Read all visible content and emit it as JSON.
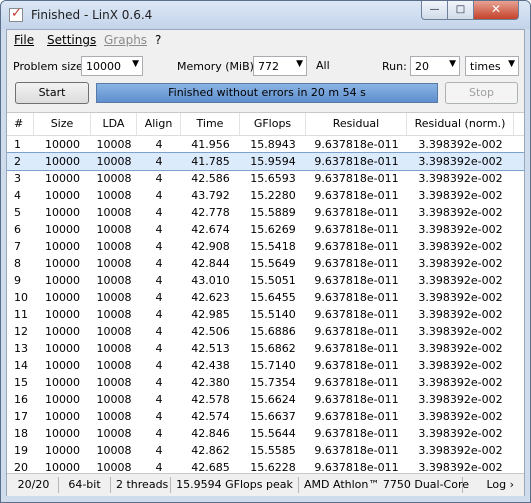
{
  "window": {
    "title": "Finished - LinX 0.6.4",
    "min_glyph": "—",
    "max_glyph": "□",
    "close_glyph": "✕",
    "app_icon_glyph": "✓",
    "app_icon_name": "checkmark-icon"
  },
  "menu": [
    {
      "label": "File",
      "enabled": true
    },
    {
      "label": "Settings",
      "enabled": true
    },
    {
      "label": "Graphs",
      "enabled": false
    },
    {
      "label": "?",
      "enabled": true
    }
  ],
  "controls": {
    "problem_size_label": "Problem size:",
    "problem_size_value": "10000",
    "memory_label": "Memory (MiB):",
    "memory_value": "772",
    "all_label": "All",
    "run_label": "Run:",
    "run_value": "20",
    "run_unit": "times",
    "dropdown_glyph": "▼"
  },
  "buttons": {
    "start": "Start",
    "stop": "Stop"
  },
  "progress": {
    "text": "Finished without errors in 20 m 54 s",
    "fraction": 1.0
  },
  "table": {
    "columns": [
      "#",
      "Size",
      "LDA",
      "Align",
      "Time",
      "GFlops",
      "Residual",
      "Residual (norm.)"
    ],
    "selected_row": 2,
    "rows": [
      [
        "1",
        "10000",
        "10008",
        "4",
        "41.956",
        "15.8943",
        "9.637818e-011",
        "3.398392e-002"
      ],
      [
        "2",
        "10000",
        "10008",
        "4",
        "41.785",
        "15.9594",
        "9.637818e-011",
        "3.398392e-002"
      ],
      [
        "3",
        "10000",
        "10008",
        "4",
        "42.586",
        "15.6593",
        "9.637818e-011",
        "3.398392e-002"
      ],
      [
        "4",
        "10000",
        "10008",
        "4",
        "43.792",
        "15.2280",
        "9.637818e-011",
        "3.398392e-002"
      ],
      [
        "5",
        "10000",
        "10008",
        "4",
        "42.778",
        "15.5889",
        "9.637818e-011",
        "3.398392e-002"
      ],
      [
        "6",
        "10000",
        "10008",
        "4",
        "42.674",
        "15.6269",
        "9.637818e-011",
        "3.398392e-002"
      ],
      [
        "7",
        "10000",
        "10008",
        "4",
        "42.908",
        "15.5418",
        "9.637818e-011",
        "3.398392e-002"
      ],
      [
        "8",
        "10000",
        "10008",
        "4",
        "42.844",
        "15.5649",
        "9.637818e-011",
        "3.398392e-002"
      ],
      [
        "9",
        "10000",
        "10008",
        "4",
        "43.010",
        "15.5051",
        "9.637818e-011",
        "3.398392e-002"
      ],
      [
        "10",
        "10000",
        "10008",
        "4",
        "42.623",
        "15.6455",
        "9.637818e-011",
        "3.398392e-002"
      ],
      [
        "11",
        "10000",
        "10008",
        "4",
        "42.985",
        "15.5140",
        "9.637818e-011",
        "3.398392e-002"
      ],
      [
        "12",
        "10000",
        "10008",
        "4",
        "42.506",
        "15.6886",
        "9.637818e-011",
        "3.398392e-002"
      ],
      [
        "13",
        "10000",
        "10008",
        "4",
        "42.513",
        "15.6862",
        "9.637818e-011",
        "3.398392e-002"
      ],
      [
        "14",
        "10000",
        "10008",
        "4",
        "42.438",
        "15.7140",
        "9.637818e-011",
        "3.398392e-002"
      ],
      [
        "15",
        "10000",
        "10008",
        "4",
        "42.380",
        "15.7354",
        "9.637818e-011",
        "3.398392e-002"
      ],
      [
        "16",
        "10000",
        "10008",
        "4",
        "42.578",
        "15.6624",
        "9.637818e-011",
        "3.398392e-002"
      ],
      [
        "17",
        "10000",
        "10008",
        "4",
        "42.574",
        "15.6637",
        "9.637818e-011",
        "3.398392e-002"
      ],
      [
        "18",
        "10000",
        "10008",
        "4",
        "42.846",
        "15.5644",
        "9.637818e-011",
        "3.398392e-002"
      ],
      [
        "19",
        "10000",
        "10008",
        "4",
        "42.862",
        "15.5585",
        "9.637818e-011",
        "3.398392e-002"
      ],
      [
        "20",
        "10000",
        "10008",
        "4",
        "42.685",
        "15.6228",
        "9.637818e-011",
        "3.398392e-002"
      ]
    ]
  },
  "status": {
    "runs": "20/20",
    "arch": "64-bit",
    "threads": "2 threads",
    "peak": "15.9594 GFlops peak",
    "cpu": "AMD Athlon™ 7750 Dual-Core",
    "log": "Log ›"
  },
  "colors": {
    "progress_fill": "#6f9ad8",
    "selected_row": "#dcebfc"
  }
}
